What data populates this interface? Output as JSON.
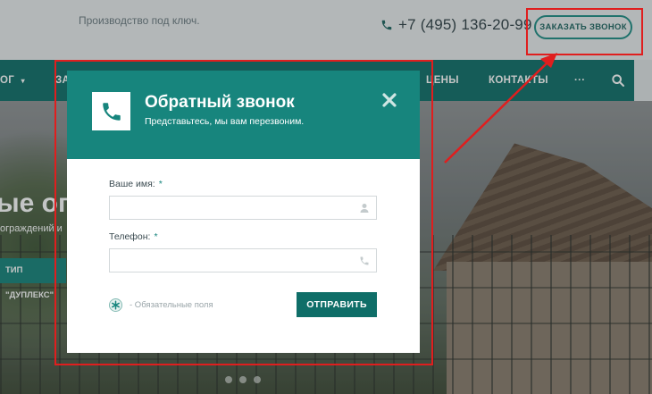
{
  "header": {
    "tagline": "Производство под ключ.",
    "phone": "+7 (495) 136-20-99",
    "callback_button": "ЗАКАЗАТЬ ЗВОНОК"
  },
  "nav": {
    "items": [
      "ОГ",
      "ЗА",
      "ЦЕНЫ",
      "КОНТАКТЫ",
      "···"
    ],
    "search_icon": "search-icon"
  },
  "hero": {
    "title_fragment": "ые огр",
    "subtitle_fragment": "ограждений и",
    "button_fragment": "ТИП \"ДУПЛЕКС\""
  },
  "modal": {
    "title": "Обратный звонок",
    "subtitle": "Представьтесь, мы вам перезвоним.",
    "name_label": "Ваше имя:",
    "name_required": "*",
    "name_value": "",
    "phone_label": "Телефон:",
    "phone_required": "*",
    "phone_value": "",
    "required_note": "- Обязательные поля",
    "submit_label": "ОТПРАВИТЬ",
    "icons": [
      "phone-icon",
      "close-icon",
      "user-icon",
      "phone-small-icon",
      "required-star-icon"
    ]
  },
  "colors": {
    "accent": "#17857d",
    "nav": "#0f6e68",
    "highlight": "#e01e1e"
  }
}
